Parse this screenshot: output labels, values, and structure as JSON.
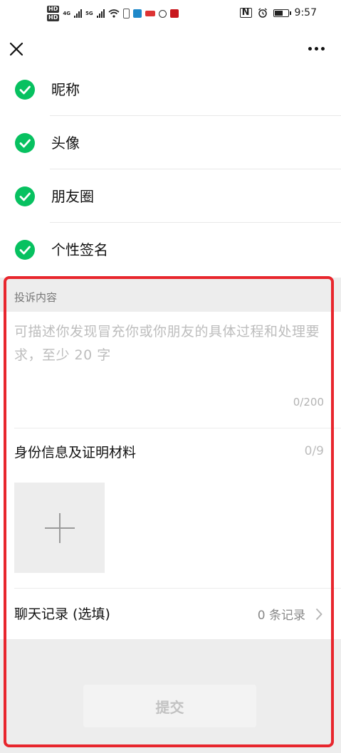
{
  "status_bar": {
    "net1": "4G",
    "net2": "5G",
    "time": "9:57"
  },
  "nav": {
    "close_icon": "close-icon",
    "more_icon": "more-dots-icon"
  },
  "checklist": [
    {
      "label": "昵称"
    },
    {
      "label": "头像"
    },
    {
      "label": "朋友圈"
    },
    {
      "label": "个性签名"
    }
  ],
  "complaint": {
    "section_title": "投诉内容",
    "placeholder": "可描述你发现冒充你或你朋友的具体过程和处理要求，至少 20 字",
    "counter": "0/200",
    "id_label": "身份信息及证明材料",
    "id_count": "0/9",
    "chat_label": "聊天记录 (选填)",
    "chat_value": "0 条记录",
    "submit_label": "提交"
  },
  "colors": {
    "check": "#07c160",
    "highlight": "#e8262d",
    "background": "#ededed"
  }
}
